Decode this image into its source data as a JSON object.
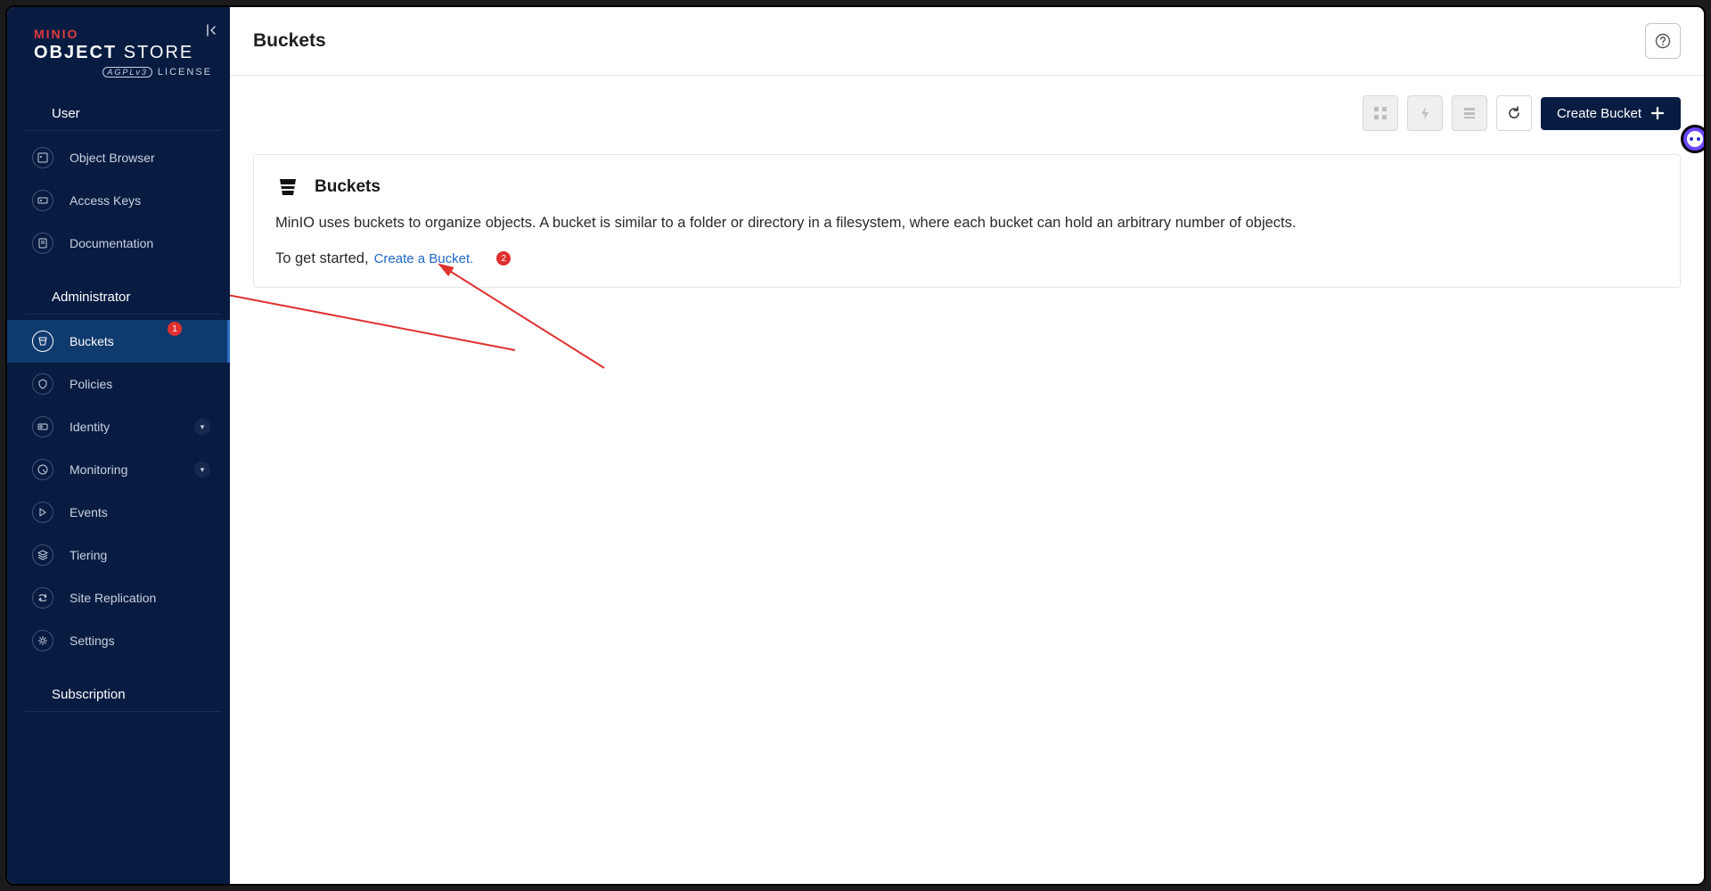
{
  "logo": {
    "brand": "MINIO",
    "line1": "OBJECT",
    "line2": "STORE",
    "agpl": "AGPLv3",
    "license": "LICENSE"
  },
  "sidebar": {
    "section_user": "User",
    "section_admin": "Administrator",
    "section_sub": "Subscription",
    "items": {
      "object_browser": "Object Browser",
      "access_keys": "Access Keys",
      "documentation": "Documentation",
      "buckets": "Buckets",
      "policies": "Policies",
      "identity": "Identity",
      "monitoring": "Monitoring",
      "events": "Events",
      "tiering": "Tiering",
      "site_replication": "Site Replication",
      "settings": "Settings"
    }
  },
  "header": {
    "title": "Buckets"
  },
  "toolbar": {
    "create_label": "Create Bucket"
  },
  "card": {
    "title": "Buckets",
    "body": "MinIO uses buckets to organize objects. A bucket is similar to a folder or directory in a filesystem, where each bucket can hold an arbitrary number of objects.",
    "cta_prefix": "To get started,",
    "cta_link": "Create a Bucket."
  },
  "annotations": {
    "badge1": "1",
    "badge2": "2"
  }
}
